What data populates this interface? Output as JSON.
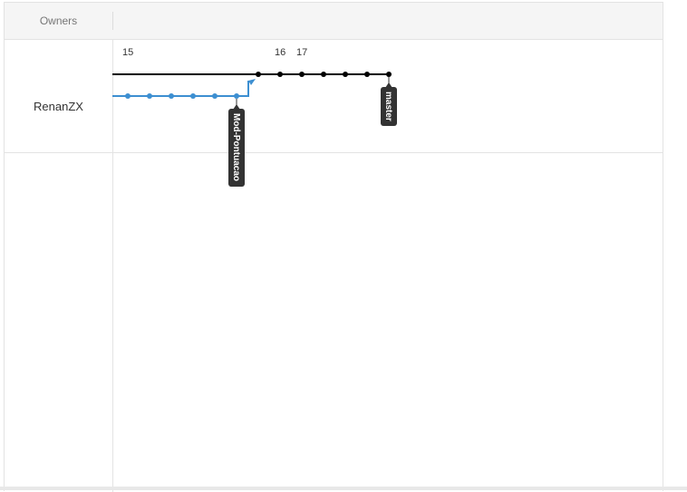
{
  "header": {
    "owners_label": "Owners"
  },
  "owners": [
    {
      "name": "RenanZX"
    }
  ],
  "timeline": {
    "labels": [
      "15",
      "16",
      "17"
    ]
  },
  "branches": [
    {
      "name": "master",
      "color": "#000000",
      "commit_count": 7
    },
    {
      "name": "Mod-Pontuacao",
      "color": "#3d8fd1",
      "commit_count": 6
    }
  ],
  "tags": {
    "master": "master",
    "mod": "Mod-Pontuacao"
  },
  "colors": {
    "master_line": "#000000",
    "branch_line": "#3d8fd1",
    "tag_background": "#333333",
    "tag_text": "#ffffff"
  }
}
